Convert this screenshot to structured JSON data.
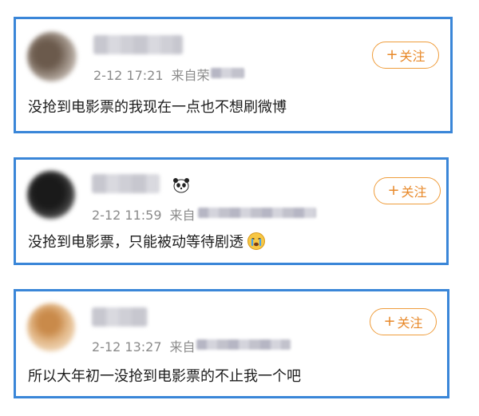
{
  "posts": [
    {
      "time": "2-12 17:21",
      "source_prefix": "来自荣",
      "follow_plus": "+",
      "follow_label": "关注",
      "content": "没抢到电影票的我现在一点也不想刷微博"
    },
    {
      "time": "2-12 11:59",
      "source_prefix": "来自",
      "follow_plus": "+",
      "follow_label": "关注",
      "content": "没抢到电影票，只能被动等待剧透",
      "badge_icon": "panda-icon",
      "emoji_icon": "crying-face-icon"
    },
    {
      "time": "2-12 13:27",
      "source_prefix": "来自",
      "follow_plus": "+",
      "follow_label": "关注",
      "content": "所以大年初一没抢到电影票的不止我一个吧"
    }
  ],
  "colors": {
    "card_border": "#3a86d8",
    "follow_accent": "#e8892a",
    "meta_text": "#8b8b8b"
  }
}
